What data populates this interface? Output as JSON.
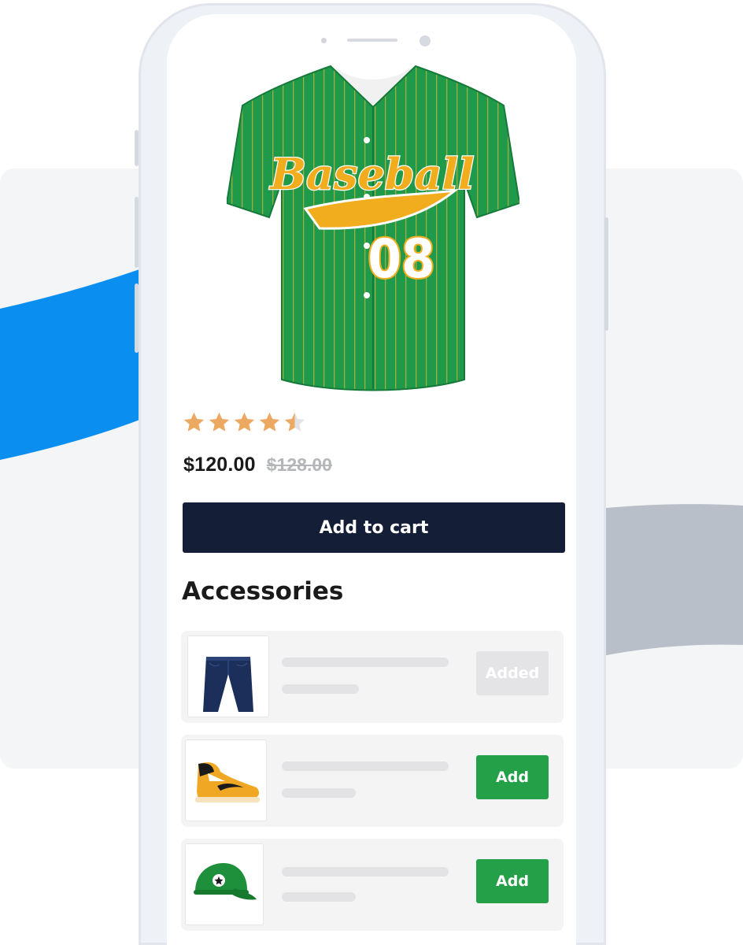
{
  "colors": {
    "accent_blue": "#0a8ef0",
    "gray_wave": "#b8bfc8",
    "dark_button": "#141e37",
    "add_green": "#24a148",
    "star": "#eba962"
  },
  "product": {
    "image_icon": "baseball-jersey",
    "jersey_script": "Baseball",
    "jersey_number": "08",
    "rating": 4.5,
    "rating_max": 5,
    "price": "$120.00",
    "old_price": "$128.00",
    "add_to_cart_label": "Add to cart"
  },
  "accessories": {
    "title": "Accessories",
    "items": [
      {
        "icon": "jeans",
        "button_label": "Added",
        "state": "added"
      },
      {
        "icon": "sneaker",
        "button_label": "Add",
        "state": "add"
      },
      {
        "icon": "cap",
        "button_label": "Add",
        "state": "add"
      }
    ]
  }
}
